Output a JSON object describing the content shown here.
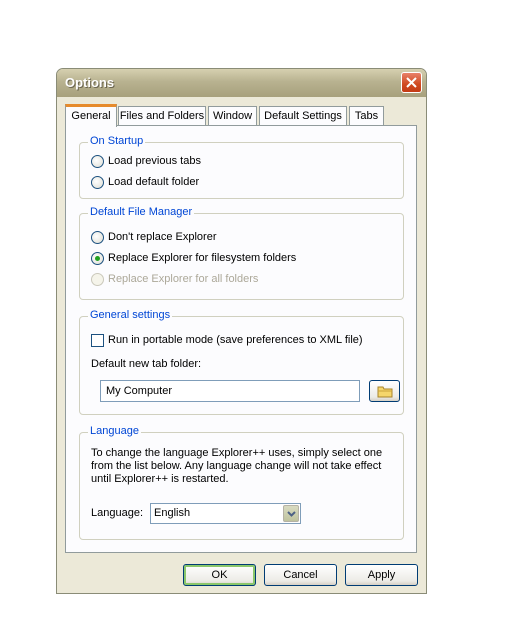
{
  "window": {
    "title": "Options"
  },
  "tabs": [
    {
      "label": "General",
      "active": true
    },
    {
      "label": "Files and Folders",
      "active": false
    },
    {
      "label": "Window",
      "active": false
    },
    {
      "label": "Default Settings",
      "active": false
    },
    {
      "label": "Tabs",
      "active": false
    }
  ],
  "on_startup": {
    "title": "On Startup",
    "options": [
      {
        "label": "Load previous tabs",
        "selected": false
      },
      {
        "label": "Load default folder",
        "selected": false
      }
    ]
  },
  "default_file_manager": {
    "title": "Default File Manager",
    "options": [
      {
        "label": "Don't replace Explorer",
        "selected": false,
        "enabled": true
      },
      {
        "label": "Replace Explorer for filesystem folders",
        "selected": true,
        "enabled": true
      },
      {
        "label": "Replace Explorer for all folders",
        "selected": false,
        "enabled": false
      }
    ]
  },
  "general_settings": {
    "title": "General settings",
    "portable_mode_label": "Run in portable mode (save preferences to XML file)",
    "portable_mode_checked": false,
    "default_folder_label": "Default new tab folder:",
    "default_folder_value": "My Computer",
    "browse_icon": "folder-icon"
  },
  "language": {
    "title": "Language",
    "description": "To change the language Explorer++ uses, simply select one from the list below. Any language change will not take effect until Explorer++ is restarted.",
    "label": "Language:",
    "selected": "English"
  },
  "buttons": {
    "ok": "OK",
    "cancel": "Cancel",
    "apply": "Apply"
  },
  "colors": {
    "group_title": "#0046d5",
    "active_tab_accent": "#e68b2c",
    "close_button": "#d0491f"
  }
}
